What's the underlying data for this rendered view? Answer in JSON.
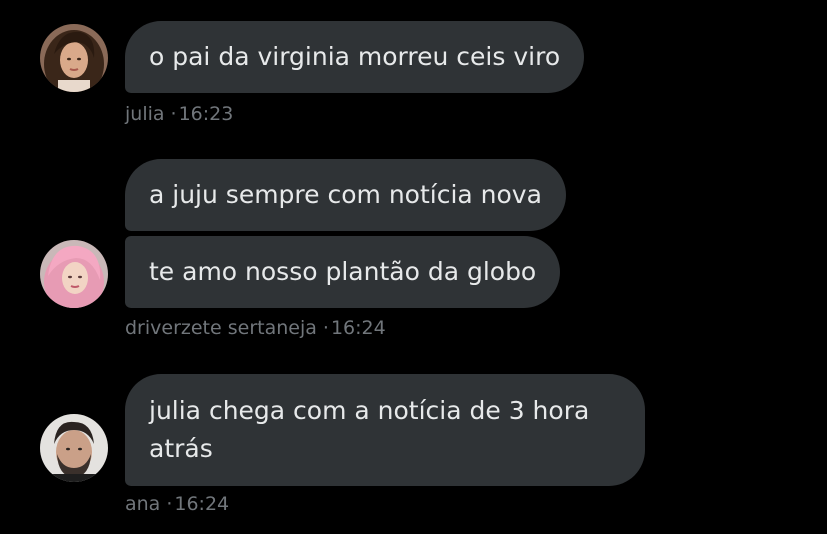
{
  "conversation": {
    "groups": [
      {
        "sender": "julia",
        "time": "16:23",
        "separator": "·",
        "messages": [
          "o pai da virginia morreu ceis viro"
        ],
        "avatar": "woman-dark-hair-photo"
      },
      {
        "sender": "driverzete sertaneja",
        "time": "16:24",
        "separator": "·",
        "messages": [
          "a juju sempre com notícia nova",
          "te amo nosso plantão da globo"
        ],
        "avatar": "woman-pink-hair-photo"
      },
      {
        "sender": "ana",
        "time": "16:24",
        "separator": "·",
        "messages": [
          "julia chega com a notícia de 3 hora atrás"
        ],
        "avatar": "man-beard-photo"
      }
    ]
  },
  "colors": {
    "background": "#000000",
    "bubble": "#2f3336",
    "bubble_text": "#e7e9ea",
    "meta_text": "#71767b"
  }
}
